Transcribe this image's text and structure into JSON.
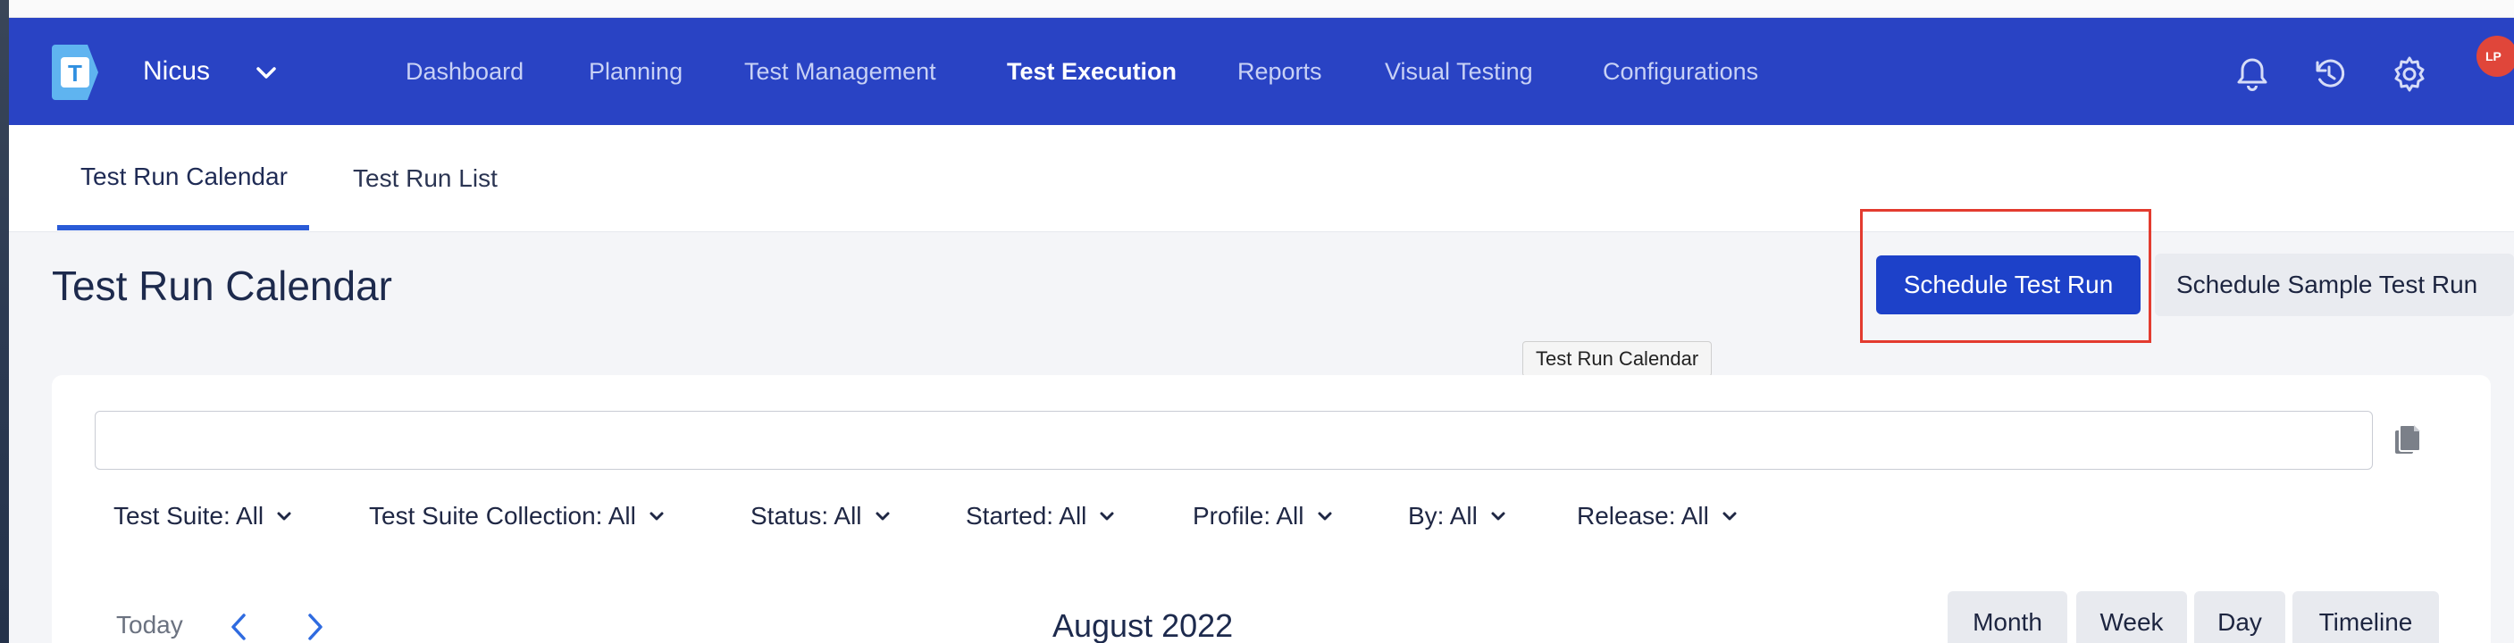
{
  "app": {
    "project_name": "Nicus",
    "logo_letter": "T",
    "user_initials": "LP"
  },
  "nav": {
    "items": [
      {
        "label": "Dashboard",
        "active": false
      },
      {
        "label": "Planning",
        "active": false
      },
      {
        "label": "Test Management",
        "active": false
      },
      {
        "label": "Test Execution",
        "active": true
      },
      {
        "label": "Reports",
        "active": false
      },
      {
        "label": "Visual Testing",
        "active": false
      },
      {
        "label": "Configurations",
        "active": false
      }
    ],
    "icons": [
      "bell-icon",
      "history-icon",
      "gear-icon"
    ]
  },
  "subtabs": [
    {
      "label": "Test Run Calendar",
      "active": true
    },
    {
      "label": "Test Run List",
      "active": false
    }
  ],
  "page": {
    "title": "Test Run Calendar",
    "primary_button": "Schedule Test Run",
    "secondary_button": "Schedule Sample Test Run",
    "tooltip": "Test Run Calendar"
  },
  "search": {
    "value": "",
    "placeholder": ""
  },
  "filters": [
    {
      "label": "Test Suite: All"
    },
    {
      "label": "Test Suite Collection: All"
    },
    {
      "label": "Status: All"
    },
    {
      "label": "Started: All"
    },
    {
      "label": "Profile: All"
    },
    {
      "label": "By: All"
    },
    {
      "label": "Release: All"
    }
  ],
  "calendar": {
    "today_label": "Today",
    "current_period": "August 2022",
    "views": [
      "Month",
      "Week",
      "Day",
      "Timeline"
    ]
  },
  "colors": {
    "nav_bg": "#2943c4",
    "primary": "#1d41c9",
    "highlight": "#e33b2f",
    "avatar": "#e0463a"
  }
}
